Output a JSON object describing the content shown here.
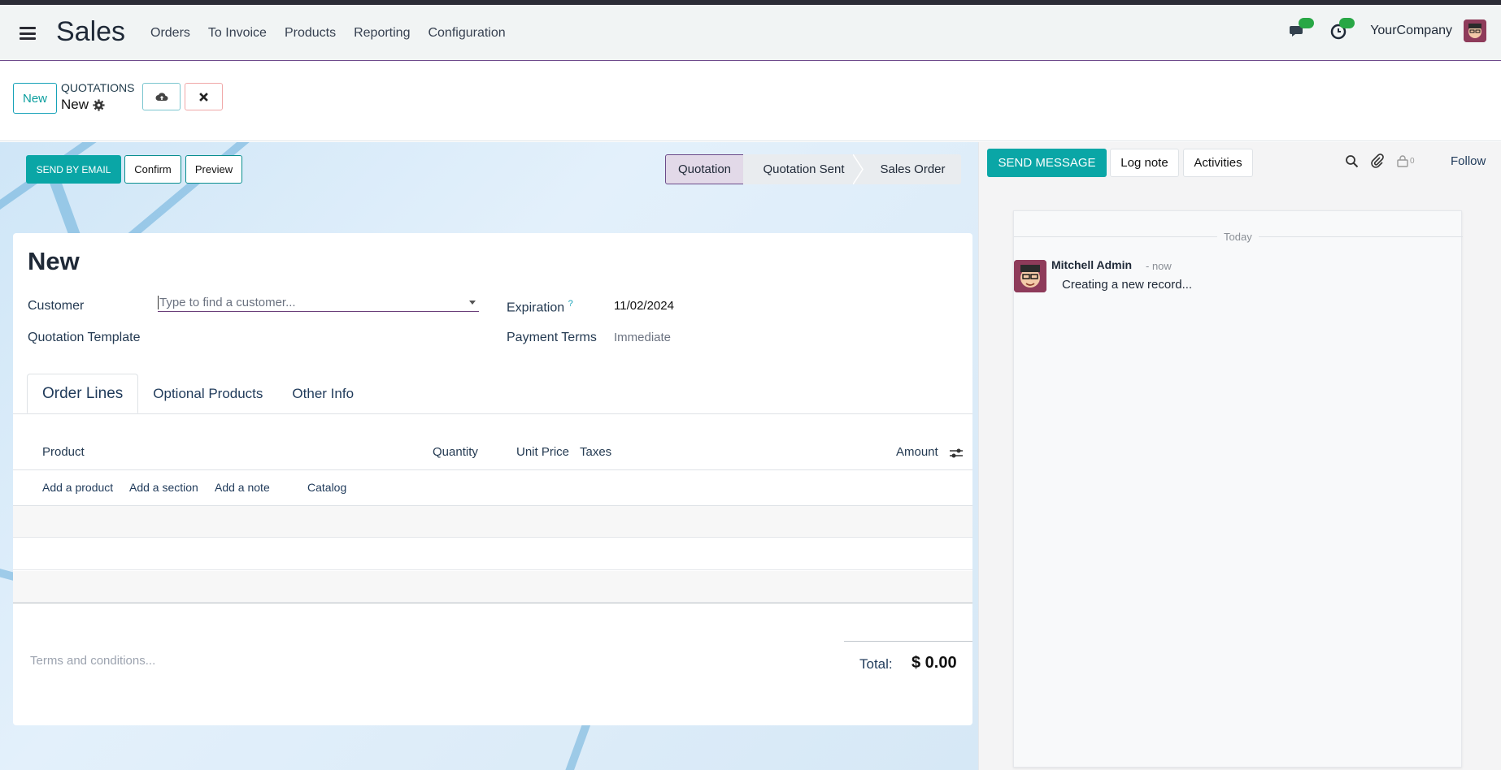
{
  "navbar": {
    "app_title": "Sales",
    "menu": [
      "Orders",
      "To Invoice",
      "Products",
      "Reporting",
      "Configuration"
    ],
    "company": "YourCompany"
  },
  "control": {
    "new_label": "New",
    "breadcrumb_parent": "QUOTATIONS",
    "breadcrumb_current": "New"
  },
  "actions": {
    "send_email": "SEND BY EMAIL",
    "confirm": "Confirm",
    "preview": "Preview"
  },
  "status": {
    "stages": [
      "Quotation",
      "Quotation Sent",
      "Sales Order"
    ],
    "active": "Quotation"
  },
  "form": {
    "title": "New",
    "customer_label": "Customer",
    "customer_placeholder": "Type to find a customer...",
    "template_label": "Quotation Template",
    "expiration_label": "Expiration",
    "expiration_help": "?",
    "expiration_value": "11/02/2024",
    "payment_label": "Payment Terms",
    "payment_value": "Immediate"
  },
  "tabs": [
    "Order Lines",
    "Optional Products",
    "Other Info"
  ],
  "table": {
    "headers": {
      "product": "Product",
      "quantity": "Quantity",
      "unit_price": "Unit Price",
      "taxes": "Taxes",
      "amount": "Amount"
    },
    "add_links": [
      "Add a product",
      "Add a section",
      "Add a note",
      "Catalog"
    ]
  },
  "footer": {
    "terms_placeholder": "Terms and conditions...",
    "total_label": "Total:",
    "total_value": "$ 0.00"
  },
  "chatter": {
    "send_message": "SEND MESSAGE",
    "log_note": "Log note",
    "activities": "Activities",
    "followers_count": "0",
    "follow": "Follow",
    "date_separator": "Today",
    "message": {
      "author": "Mitchell Admin",
      "time": "- now",
      "body": "Creating a new record..."
    }
  },
  "colors": {
    "primary": "#0aa6a6",
    "brand": "#6c4b8a"
  }
}
